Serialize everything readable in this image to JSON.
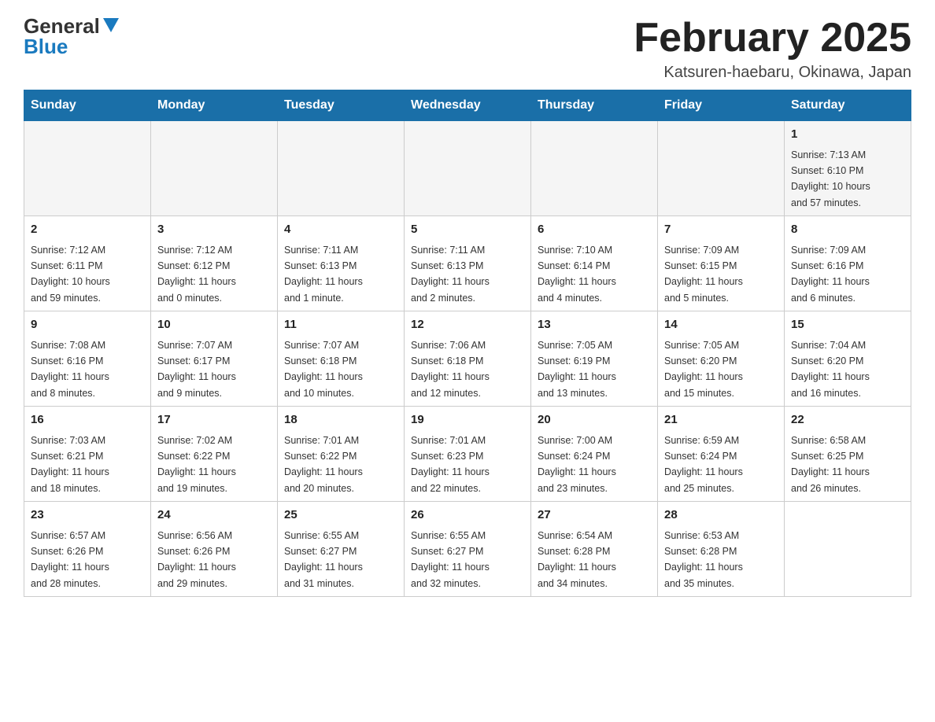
{
  "logo": {
    "general": "General",
    "blue": "Blue"
  },
  "title": "February 2025",
  "location": "Katsuren-haebaru, Okinawa, Japan",
  "weekdays": [
    "Sunday",
    "Monday",
    "Tuesday",
    "Wednesday",
    "Thursday",
    "Friday",
    "Saturday"
  ],
  "weeks": [
    [
      {
        "day": null,
        "info": null
      },
      {
        "day": null,
        "info": null
      },
      {
        "day": null,
        "info": null
      },
      {
        "day": null,
        "info": null
      },
      {
        "day": null,
        "info": null
      },
      {
        "day": null,
        "info": null
      },
      {
        "day": "1",
        "info": "Sunrise: 7:13 AM\nSunset: 6:10 PM\nDaylight: 10 hours\nand 57 minutes."
      }
    ],
    [
      {
        "day": "2",
        "info": "Sunrise: 7:12 AM\nSunset: 6:11 PM\nDaylight: 10 hours\nand 59 minutes."
      },
      {
        "day": "3",
        "info": "Sunrise: 7:12 AM\nSunset: 6:12 PM\nDaylight: 11 hours\nand 0 minutes."
      },
      {
        "day": "4",
        "info": "Sunrise: 7:11 AM\nSunset: 6:13 PM\nDaylight: 11 hours\nand 1 minute."
      },
      {
        "day": "5",
        "info": "Sunrise: 7:11 AM\nSunset: 6:13 PM\nDaylight: 11 hours\nand 2 minutes."
      },
      {
        "day": "6",
        "info": "Sunrise: 7:10 AM\nSunset: 6:14 PM\nDaylight: 11 hours\nand 4 minutes."
      },
      {
        "day": "7",
        "info": "Sunrise: 7:09 AM\nSunset: 6:15 PM\nDaylight: 11 hours\nand 5 minutes."
      },
      {
        "day": "8",
        "info": "Sunrise: 7:09 AM\nSunset: 6:16 PM\nDaylight: 11 hours\nand 6 minutes."
      }
    ],
    [
      {
        "day": "9",
        "info": "Sunrise: 7:08 AM\nSunset: 6:16 PM\nDaylight: 11 hours\nand 8 minutes."
      },
      {
        "day": "10",
        "info": "Sunrise: 7:07 AM\nSunset: 6:17 PM\nDaylight: 11 hours\nand 9 minutes."
      },
      {
        "day": "11",
        "info": "Sunrise: 7:07 AM\nSunset: 6:18 PM\nDaylight: 11 hours\nand 10 minutes."
      },
      {
        "day": "12",
        "info": "Sunrise: 7:06 AM\nSunset: 6:18 PM\nDaylight: 11 hours\nand 12 minutes."
      },
      {
        "day": "13",
        "info": "Sunrise: 7:05 AM\nSunset: 6:19 PM\nDaylight: 11 hours\nand 13 minutes."
      },
      {
        "day": "14",
        "info": "Sunrise: 7:05 AM\nSunset: 6:20 PM\nDaylight: 11 hours\nand 15 minutes."
      },
      {
        "day": "15",
        "info": "Sunrise: 7:04 AM\nSunset: 6:20 PM\nDaylight: 11 hours\nand 16 minutes."
      }
    ],
    [
      {
        "day": "16",
        "info": "Sunrise: 7:03 AM\nSunset: 6:21 PM\nDaylight: 11 hours\nand 18 minutes."
      },
      {
        "day": "17",
        "info": "Sunrise: 7:02 AM\nSunset: 6:22 PM\nDaylight: 11 hours\nand 19 minutes."
      },
      {
        "day": "18",
        "info": "Sunrise: 7:01 AM\nSunset: 6:22 PM\nDaylight: 11 hours\nand 20 minutes."
      },
      {
        "day": "19",
        "info": "Sunrise: 7:01 AM\nSunset: 6:23 PM\nDaylight: 11 hours\nand 22 minutes."
      },
      {
        "day": "20",
        "info": "Sunrise: 7:00 AM\nSunset: 6:24 PM\nDaylight: 11 hours\nand 23 minutes."
      },
      {
        "day": "21",
        "info": "Sunrise: 6:59 AM\nSunset: 6:24 PM\nDaylight: 11 hours\nand 25 minutes."
      },
      {
        "day": "22",
        "info": "Sunrise: 6:58 AM\nSunset: 6:25 PM\nDaylight: 11 hours\nand 26 minutes."
      }
    ],
    [
      {
        "day": "23",
        "info": "Sunrise: 6:57 AM\nSunset: 6:26 PM\nDaylight: 11 hours\nand 28 minutes."
      },
      {
        "day": "24",
        "info": "Sunrise: 6:56 AM\nSunset: 6:26 PM\nDaylight: 11 hours\nand 29 minutes."
      },
      {
        "day": "25",
        "info": "Sunrise: 6:55 AM\nSunset: 6:27 PM\nDaylight: 11 hours\nand 31 minutes."
      },
      {
        "day": "26",
        "info": "Sunrise: 6:55 AM\nSunset: 6:27 PM\nDaylight: 11 hours\nand 32 minutes."
      },
      {
        "day": "27",
        "info": "Sunrise: 6:54 AM\nSunset: 6:28 PM\nDaylight: 11 hours\nand 34 minutes."
      },
      {
        "day": "28",
        "info": "Sunrise: 6:53 AM\nSunset: 6:28 PM\nDaylight: 11 hours\nand 35 minutes."
      },
      {
        "day": null,
        "info": null
      }
    ]
  ]
}
